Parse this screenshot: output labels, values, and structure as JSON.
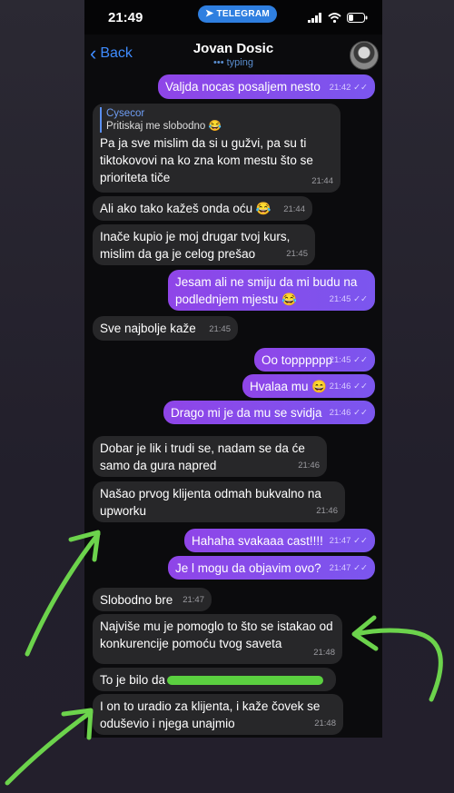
{
  "status_bar": {
    "time": "21:49",
    "app_pill": "TELEGRAM"
  },
  "header": {
    "back": "Back",
    "contact_name": "Jovan Dosic",
    "status": "typing"
  },
  "messages": [
    {
      "dir": "out",
      "text": "Valjda nocas posaljem nesto",
      "time": "21:42"
    },
    {
      "dir": "in",
      "reply_name": "Cysecor",
      "reply_text": "Pritiskaj me slobodno 😂",
      "text": "Pa ja sve mislim da si u gužvi, pa su ti tiktokovovi na ko zna kom mestu što se prioriteta tiče",
      "time": "21:44"
    },
    {
      "dir": "in",
      "text": "Ali ako tako kažeš onda oću 😂",
      "time": "21:44"
    },
    {
      "dir": "in",
      "text": "Inače kupio je moj drugar tvoj kurs, mislim da ga je celog prešao",
      "time": "21:45"
    },
    {
      "dir": "out",
      "text": "Jesam ali ne smiju da mi budu na podlednjem mjestu 😂",
      "time": "21:45"
    },
    {
      "dir": "in",
      "text": "Sve najbolje kaže",
      "time": "21:45"
    },
    {
      "dir": "out",
      "text": "Oo topppppp",
      "time": "21:45"
    },
    {
      "dir": "out",
      "text": "Hvalaa mu 😄",
      "time": "21:46"
    },
    {
      "dir": "out",
      "text": "Drago mi je da mu se svidja",
      "time": "21:46"
    },
    {
      "dir": "in",
      "text": "Dobar je lik i trudi se, nadam se da će samo da gura napred",
      "time": "21:46"
    },
    {
      "dir": "in",
      "text": "Našao prvog klijenta odmah bukvalno na upworku",
      "time": "21:46"
    },
    {
      "dir": "out",
      "text": "Hahaha svakaaa cast!!!!",
      "time": "21:47"
    },
    {
      "dir": "out",
      "text": "Je l mogu da objavim ovo?",
      "time": "21:47"
    },
    {
      "dir": "in",
      "text": "Slobodno bre",
      "time": "21:47"
    },
    {
      "dir": "in",
      "text": "Najviše mu je pomoglo to što se istakao od konkurencije pomoću tvog saveta",
      "time": "21:48"
    },
    {
      "dir": "in",
      "text": "To je bilo da",
      "time": ""
    },
    {
      "dir": "in",
      "text": "I on to uradio za klijenta, i kaže čovek se oduševio i njega unajmio",
      "time": "21:48"
    }
  ],
  "colors": {
    "outgoing_bubble": "#8a4ae9",
    "incoming_bubble": "#272729",
    "accent_link": "#3f8cff",
    "annotation_arrows": "#6cd34c",
    "redaction": "#5bd040"
  },
  "icons": [
    "chevron-left-icon",
    "telegram-plane-icon",
    "signal-icon",
    "wifi-icon",
    "battery-icon",
    "read-check-icon"
  ]
}
